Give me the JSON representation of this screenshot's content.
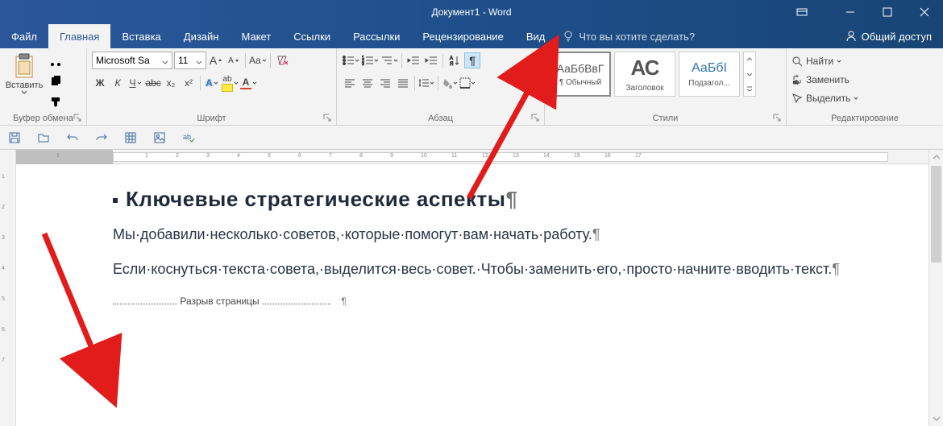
{
  "title": "Документ1 - Word",
  "tabs": {
    "file": "Файл",
    "home": "Главная",
    "insert": "Вставка",
    "design": "Дизайн",
    "layout": "Макет",
    "references": "Ссылки",
    "mailings": "Рассылки",
    "review": "Рецензирование",
    "view": "Вид"
  },
  "tell_me": "Что вы хотите сделать?",
  "share": "Общий доступ",
  "clipboard": {
    "paste": "Вставить",
    "label": "Буфер обмена"
  },
  "font": {
    "name": "Microsoft Sa",
    "size": "11",
    "label": "Шрифт",
    "bold": "Ж",
    "italic": "К",
    "underline": "Ч",
    "strike": "abc",
    "sub": "x₂",
    "sup": "x²",
    "caseBtn": "Aa",
    "growA": "A",
    "shrinkA": "A",
    "textfx": "A",
    "highlight": "ab"
  },
  "paragraph": {
    "label": "Абзац"
  },
  "styles": {
    "label": "Стили",
    "normal_sample": "АаБбВвГ",
    "normal_label": "¶ Обычный",
    "heading_sample": "АС",
    "heading_label": "Заголовок",
    "sub_sample": "АаБбІ",
    "sub_label": "Подзагол..."
  },
  "editing": {
    "label": "Редактирование",
    "find": "Найти",
    "replace": "Заменить",
    "select": "Выделить"
  },
  "document": {
    "heading": "Ключевые стратегические аспекты",
    "para1": "Мы·добавили·несколько·советов,·которые·помогут·вам·начать·работу.",
    "para2": "Если·коснуться·текста·совета,·выделится·весь·совет.·Чтобы·заменить·его,·просто·начните·вводить·текст.",
    "pagebreak": "Разрыв страницы",
    "pilcrow": "¶"
  }
}
